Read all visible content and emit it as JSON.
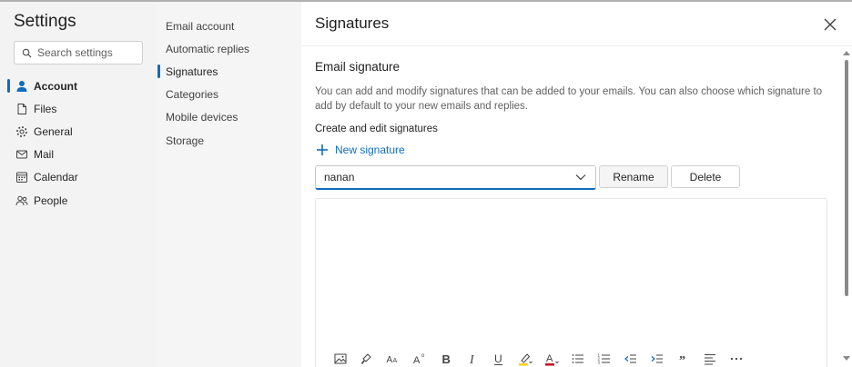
{
  "app": {
    "title": "Settings"
  },
  "search": {
    "placeholder": "Search settings"
  },
  "primary_nav": [
    {
      "label": "Account",
      "icon": "person-icon",
      "active": true
    },
    {
      "label": "Files",
      "icon": "file-icon",
      "active": false
    },
    {
      "label": "General",
      "icon": "gear-icon",
      "active": false
    },
    {
      "label": "Mail",
      "icon": "mail-icon",
      "active": false
    },
    {
      "label": "Calendar",
      "icon": "calendar-icon",
      "active": false
    },
    {
      "label": "People",
      "icon": "people-icon",
      "active": false
    }
  ],
  "secondary_nav": [
    {
      "label": "Email account",
      "active": false
    },
    {
      "label": "Automatic replies",
      "active": false
    },
    {
      "label": "Signatures",
      "active": true
    },
    {
      "label": "Categories",
      "active": false
    },
    {
      "label": "Mobile devices",
      "active": false
    },
    {
      "label": "Storage",
      "active": false
    }
  ],
  "panel": {
    "title": "Signatures",
    "section_title": "Email signature",
    "description": "You can add and modify signatures that can be added to your emails. You can also choose which signature to add by default to your new emails and replies.",
    "create_edit_label": "Create and edit signatures",
    "new_signature_label": "New signature",
    "selected_signature": "nanan",
    "rename_label": "Rename",
    "delete_label": "Delete"
  },
  "toolbar": {
    "items": [
      "insert-image-icon",
      "format-painter-icon",
      "font-size-icon",
      "superscript-icon",
      "bold-icon",
      "italic-icon",
      "underline-icon",
      "highlight-icon",
      "font-color-icon",
      "bullets-icon",
      "numbering-icon",
      "decrease-indent-icon",
      "increase-indent-icon",
      "quote-icon",
      "align-icon",
      "more-options-icon"
    ]
  },
  "colors": {
    "accent": "#0f6cbd",
    "highlight": "#ffd300",
    "font_color": "#c50f1f"
  }
}
